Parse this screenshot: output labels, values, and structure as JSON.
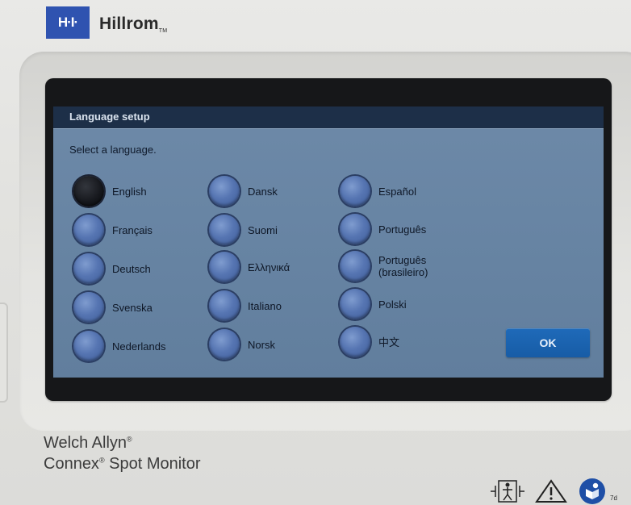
{
  "brand": {
    "logo_text": "H·I·",
    "name": "Hillrom",
    "trademark": "TM"
  },
  "dialog": {
    "title": "Language setup",
    "prompt": "Select a language.",
    "languages": [
      {
        "label": "English",
        "selected": true
      },
      {
        "label": "Français",
        "selected": false
      },
      {
        "label": "Deutsch",
        "selected": false
      },
      {
        "label": "Svenska",
        "selected": false
      },
      {
        "label": "Nederlands",
        "selected": false
      },
      {
        "label": "Dansk",
        "selected": false
      },
      {
        "label": "Suomi",
        "selected": false
      },
      {
        "label": "Ελληνικά",
        "selected": false
      },
      {
        "label": "Italiano",
        "selected": false
      },
      {
        "label": "Norsk",
        "selected": false
      },
      {
        "label": "Español",
        "selected": false
      },
      {
        "label": "Português",
        "selected": false
      },
      {
        "label": "Português\n(brasileiro)",
        "selected": false
      },
      {
        "label": "Polski",
        "selected": false
      },
      {
        "label": "中文",
        "selected": false
      }
    ],
    "ok_label": "OK"
  },
  "device": {
    "brand_line": "Welch Allyn",
    "model_prefix": "Connex",
    "model_suffix": " Spot Monitor",
    "registered": "®"
  },
  "symbols": {
    "icons": [
      "defibrillation-proof-type-bf-icon",
      "warning-icon",
      "consult-instructions-icon"
    ],
    "instructions_suffix": "7d"
  },
  "colors": {
    "dialog_bg": "#6784a3",
    "header_bg": "#1d2f48",
    "ok_button": "#1f6ab9",
    "brand_blue": "#2f53b0"
  }
}
